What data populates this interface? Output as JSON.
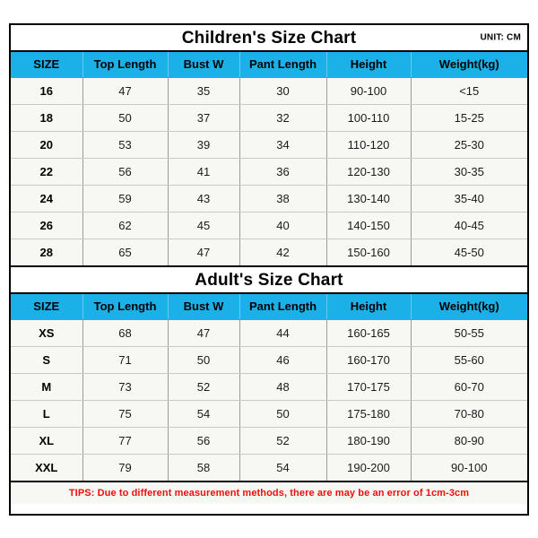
{
  "children": {
    "title": "Children's Size Chart",
    "unit_label": "UNIT: CM",
    "columns": [
      "SIZE",
      "Top Length",
      "Bust W",
      "Pant Length",
      "Height",
      "Weight(kg)"
    ],
    "rows": [
      [
        "16",
        "47",
        "35",
        "30",
        "90-100",
        "<15"
      ],
      [
        "18",
        "50",
        "37",
        "32",
        "100-110",
        "15-25"
      ],
      [
        "20",
        "53",
        "39",
        "34",
        "110-120",
        "25-30"
      ],
      [
        "22",
        "56",
        "41",
        "36",
        "120-130",
        "30-35"
      ],
      [
        "24",
        "59",
        "43",
        "38",
        "130-140",
        "35-40"
      ],
      [
        "26",
        "62",
        "45",
        "40",
        "140-150",
        "40-45"
      ],
      [
        "28",
        "65",
        "47",
        "42",
        "150-160",
        "45-50"
      ]
    ]
  },
  "adult": {
    "title": "Adult's Size Chart",
    "columns": [
      "SIZE",
      "Top Length",
      "Bust W",
      "Pant Length",
      "Height",
      "Weight(kg)"
    ],
    "rows": [
      [
        "XS",
        "68",
        "47",
        "44",
        "160-165",
        "50-55"
      ],
      [
        "S",
        "71",
        "50",
        "46",
        "160-170",
        "55-60"
      ],
      [
        "M",
        "73",
        "52",
        "48",
        "170-175",
        "60-70"
      ],
      [
        "L",
        "75",
        "54",
        "50",
        "175-180",
        "70-80"
      ],
      [
        "XL",
        "77",
        "56",
        "52",
        "180-190",
        "80-90"
      ],
      [
        "XXL",
        "79",
        "58",
        "54",
        "190-200",
        "90-100"
      ]
    ]
  },
  "footer": {
    "tips": "TIPS: Due to different measurement methods, there are may be an error of 1cm-3cm"
  },
  "colors": {
    "header_cyan": "#1cb0e8",
    "row_bg": "#f7f8f4",
    "tips_red": "#f20d0d",
    "border_black": "#000000"
  }
}
